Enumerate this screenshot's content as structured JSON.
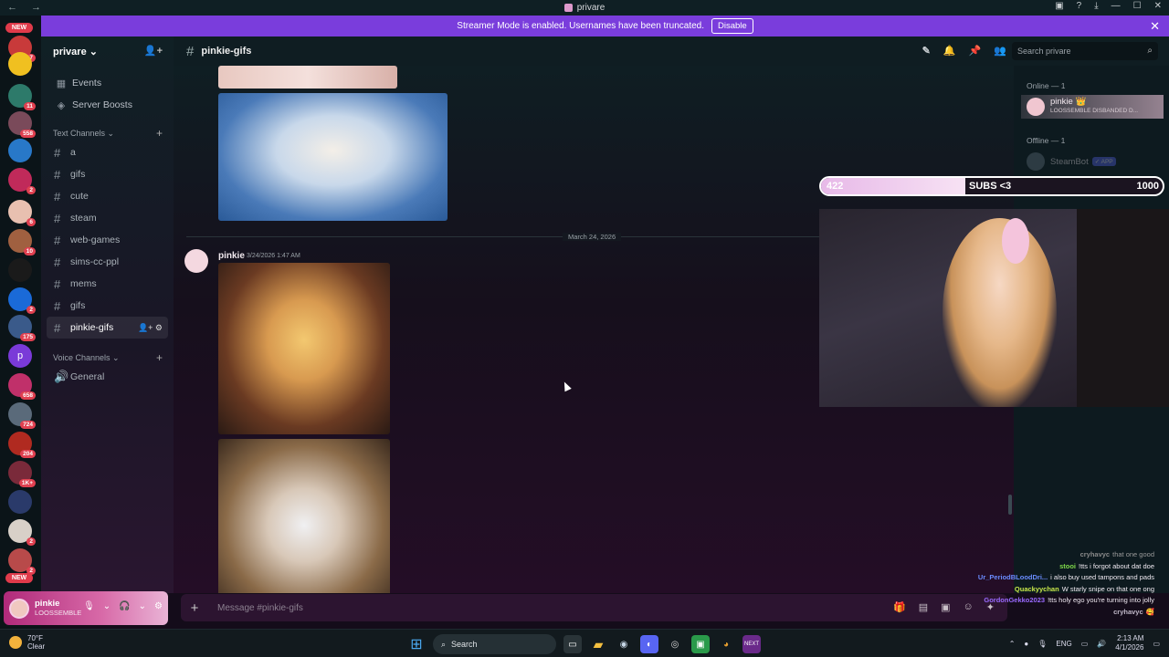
{
  "titlebar": {
    "title": "privare"
  },
  "banner": {
    "text": "Streamer Mode is enabled. Usernames have been truncated.",
    "button": "Disable"
  },
  "rail": {
    "new_top": "NEW",
    "new_bottom": "NEW",
    "badges": [
      "7",
      "11",
      "558",
      "2",
      "6",
      "10",
      "2",
      "175",
      "658",
      "724",
      "204",
      "1K+",
      "2",
      "2"
    ]
  },
  "server": {
    "name": "privare ⌄"
  },
  "sidebar": {
    "items": [
      {
        "icon": "calendar-icon",
        "label": "Events"
      },
      {
        "icon": "boost-icon",
        "label": "Server Boosts"
      }
    ],
    "text_category": "Text Channels ⌄",
    "channels": [
      "a",
      "gifs",
      "cute",
      "steam",
      "web-games",
      "sims-cc-ppl",
      "mems",
      "gifs",
      "pinkie-gifs"
    ],
    "voice_category": "Voice Channels ⌄",
    "voice_channels": [
      "General"
    ]
  },
  "user": {
    "name": "pinkie",
    "status": "LOOSSEMBLE"
  },
  "header": {
    "channel": "pinkie-gifs",
    "search_placeholder": "Search privare"
  },
  "messages": {
    "date_divider": "March 24, 2026",
    "author": "pinkie",
    "timestamp": "3/24/2026 1:47 AM"
  },
  "composer": {
    "placeholder": "Message #pinkie-gifs"
  },
  "members": {
    "online_label": "Online — 1",
    "offline_label": "Offline — 1",
    "online": [
      {
        "name": "pinkie 👑",
        "status": "LOOSSEMBLE DISBANDED D..."
      }
    ],
    "offline": [
      {
        "name": "SteamBot",
        "tag": "✓ APP"
      }
    ]
  },
  "subs": {
    "current": "422",
    "label": "SUBS <3",
    "goal": "1000",
    "progress": 0.422
  },
  "chat": [
    {
      "user": "cryhavyc",
      "text": "that one good",
      "color": "#8a8a8a"
    },
    {
      "user": "stooi",
      "text": "!tts i forgot about dat doe",
      "color": "#7fd94a"
    },
    {
      "user": "Ur_PeriodBLoodDri...",
      "text": "i also buy used tampons and pads",
      "color": "#6a8cff"
    },
    {
      "user": "Quackyychan",
      "text": "W starly snipe on that one ong",
      "color": "#c8e84a"
    },
    {
      "user": "GordonGekko2023",
      "text": "!tts holy ego you're turning into jolly",
      "color": "#9a6aff"
    },
    {
      "user": "cryhavyc",
      "text": "🥰",
      "color": "#c0b8c8"
    }
  ],
  "taskbar": {
    "temp": "70°F",
    "condition": "Clear",
    "search": "Search",
    "lang": "ENG",
    "time": "2:13 AM",
    "date": "4/1/2026"
  }
}
